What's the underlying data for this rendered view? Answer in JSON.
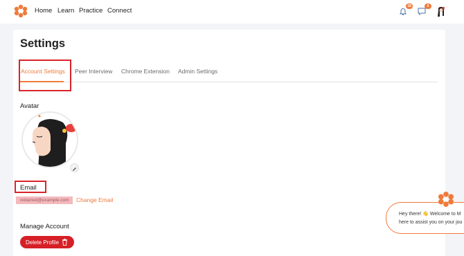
{
  "nav": {
    "links": [
      "Home",
      "Learn",
      "Practice",
      "Connect"
    ],
    "notification_count": "18",
    "message_count": "0"
  },
  "page": {
    "title": "Settings"
  },
  "tabs": [
    "Account Settings",
    "Peer Interview",
    "Chrome Extension",
    "Admin Settings"
  ],
  "avatar": {
    "label": "Avatar"
  },
  "email": {
    "label": "Email",
    "value": "redacted@example.com",
    "change_label": "Change Email"
  },
  "manage": {
    "label": "Manage Account",
    "delete_label": "Delete Profile"
  },
  "chat": {
    "line1": "Hey there! 👋 Welcome to M",
    "line2": "here to assist you on your jou"
  },
  "colors": {
    "accent": "#f07a3a",
    "danger": "#d61f26",
    "highlight": "#d8232a"
  }
}
